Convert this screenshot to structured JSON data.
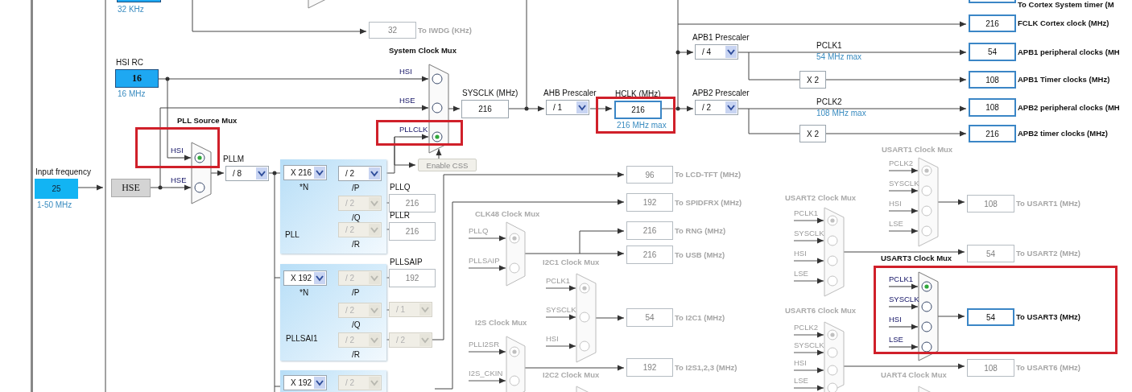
{
  "lse": {
    "note": "32 KHz"
  },
  "boxes": [
    {
      "value": "32",
      "label": "To IWDG (KHz)",
      "kind": "disabled"
    },
    {
      "caption": "HSI RC",
      "value": "16",
      "note": "16 MHz",
      "kind": "source"
    },
    {
      "caption": "Input frequency",
      "value": "25",
      "note": "1-50 MHz",
      "kind": "input"
    },
    {
      "value": "HSE",
      "kind": "block"
    },
    {
      "caption": "PLLQ",
      "value": "216",
      "kind": "disabled"
    },
    {
      "caption": "PLLR",
      "value": "216",
      "kind": "disabled"
    },
    {
      "caption": "PLLSAIP",
      "value": "192",
      "kind": "disabled"
    },
    {
      "caption": "SYSCLK (MHz)",
      "value": "216",
      "kind": "plain"
    },
    {
      "caption": "HCLK (MHz)",
      "value": "216",
      "note": "216 MHz max",
      "kind": "field",
      "highlighted": true
    },
    {
      "value": "X 2",
      "kind": "multiplier"
    },
    {
      "value": "X 2",
      "kind": "multiplier"
    },
    {
      "label": "To Cortex System timer (M",
      "kind": "output"
    },
    {
      "value": "216",
      "label": "FCLK Cortex clock (MHz)",
      "kind": "output"
    },
    {
      "value": "54",
      "label": "APB1 peripheral clocks (MH",
      "kind": "output"
    },
    {
      "value": "108",
      "label": "APB1 Timer clocks (MHz)",
      "kind": "output"
    },
    {
      "value": "108",
      "label": "APB2 peripheral clocks (MH",
      "kind": "output"
    },
    {
      "value": "216",
      "label": "APB2 timer clocks (MHz)",
      "kind": "output"
    },
    {
      "value": "96",
      "label": "To LCD-TFT (MHz)",
      "kind": "disabled"
    },
    {
      "value": "192",
      "label": "To SPIDFRX (MHz)",
      "kind": "disabled"
    },
    {
      "value": "216",
      "label": "To RNG (MHz)",
      "kind": "disabled"
    },
    {
      "value": "216",
      "label": "To USB (MHz)",
      "kind": "disabled"
    },
    {
      "value": "54",
      "label": "To I2C1 (MHz)",
      "kind": "disabled"
    },
    {
      "value": "192",
      "label": "To I2S1,2,3 (MHz)",
      "kind": "disabled"
    },
    {
      "value": "108",
      "label": "To USART1 (MHz)",
      "kind": "disabled"
    },
    {
      "value": "54",
      "label": "To USART2 (MHz)",
      "kind": "disabled"
    },
    {
      "value": "54",
      "label": "To USART3 (MHz)",
      "kind": "output"
    },
    {
      "value": "108",
      "label": "To USART6 (MHz)",
      "kind": "disabled"
    }
  ],
  "signals": [
    {
      "label": "PCLK1",
      "note": "54 MHz max"
    },
    {
      "label": "PCLK2",
      "note": "108 MHz max"
    }
  ],
  "pll_panels": [
    {
      "label": "PLL"
    },
    {
      "label": "PLLSAI1"
    }
  ],
  "dropdowns": [
    {
      "caption": "PLLM",
      "value": "/ 8",
      "disabled": false
    },
    {
      "value": "X 216",
      "sublabel": "*N",
      "disabled": false
    },
    {
      "value": "/ 2",
      "sublabel": "/P",
      "disabled": false
    },
    {
      "value": "/ 2",
      "sublabel": "/Q",
      "disabled": true
    },
    {
      "value": "/ 2",
      "sublabel": "/R",
      "disabled": true
    },
    {
      "value": "X 192",
      "sublabel": "*N",
      "disabled": false
    },
    {
      "value": "/ 2",
      "sublabel": "/P",
      "disabled": true
    },
    {
      "value": "/ 2",
      "sublabel": "/Q",
      "disabled": true
    },
    {
      "value": "/ 2",
      "sublabel": "/R",
      "disabled": true
    },
    {
      "value": "/ 1",
      "disabled": true
    },
    {
      "value": "/ 2",
      "disabled": true
    },
    {
      "value": "X 192",
      "disabled": false
    },
    {
      "value": "/ 2",
      "disabled": true
    },
    {
      "caption": "AHB Prescaler",
      "value": "/ 1",
      "disabled": false
    },
    {
      "caption": "APB1 Prescaler",
      "value": "/ 4",
      "disabled": false
    },
    {
      "caption": "APB2 Prescaler",
      "value": "/ 2",
      "disabled": false
    }
  ],
  "buttons": [
    {
      "label": "Enable CSS",
      "disabled": true
    }
  ],
  "muxes": [
    {
      "title": "PLL Source Mux",
      "active": true,
      "inputs": [
        {
          "label": "HSI",
          "selected": true,
          "highlighted": true
        },
        {
          "label": "HSE",
          "selected": false
        }
      ]
    },
    {
      "title": "System Clock Mux",
      "active": true,
      "inputs": [
        {
          "label": "HSI",
          "selected": false
        },
        {
          "label": "HSE",
          "selected": false
        },
        {
          "label": "PLLCLK",
          "selected": true,
          "highlighted": true
        }
      ]
    },
    {
      "title": "CLK48 Clock Mux",
      "active": false,
      "inputs": [
        {
          "label": "PLLQ",
          "selected": true
        },
        {
          "label": "PLLSAIP",
          "selected": false
        }
      ]
    },
    {
      "title": "I2C1 Clock Mux",
      "active": false,
      "inputs": [
        {
          "label": "PCLK1",
          "selected": true
        },
        {
          "label": "SYSCLK",
          "selected": false
        },
        {
          "label": "HSI",
          "selected": false
        }
      ]
    },
    {
      "title": "I2S Clock Mux",
      "active": false,
      "inputs": [
        {
          "label": "PLLI2SR",
          "selected": true
        },
        {
          "label": "I2S_CKIN",
          "selected": false
        }
      ]
    },
    {
      "title": "I2C2 Clock Mux",
      "active": false
    },
    {
      "title": "USART1 Clock Mux",
      "active": false,
      "inputs": [
        {
          "label": "PCLK2",
          "selected": true
        },
        {
          "label": "SYSCLK",
          "selected": false
        },
        {
          "label": "HSI",
          "selected": false
        },
        {
          "label": "LSE",
          "selected": false
        }
      ]
    },
    {
      "title": "USART2 Clock Mux",
      "active": false,
      "inputs": [
        {
          "label": "PCLK1",
          "selected": true
        },
        {
          "label": "SYSCLK",
          "selected": false
        },
        {
          "label": "HSI",
          "selected": false
        },
        {
          "label": "LSE",
          "selected": false
        }
      ]
    },
    {
      "title": "USART3 Clock Mux",
      "active": true,
      "highlighted": true,
      "inputs": [
        {
          "label": "PCLK1",
          "selected": true
        },
        {
          "label": "SYSCLK",
          "selected": false
        },
        {
          "label": "HSI",
          "selected": false
        },
        {
          "label": "LSE",
          "selected": false
        }
      ]
    },
    {
      "title": "USART6 Clock Mux",
      "active": false,
      "inputs": [
        {
          "label": "PCLK2",
          "selected": true
        },
        {
          "label": "SYSCLK",
          "selected": false
        },
        {
          "label": "HSI",
          "selected": false
        },
        {
          "label": "LSE",
          "selected": false
        }
      ]
    },
    {
      "title": "UART4 Clock Mux",
      "active": false
    }
  ]
}
